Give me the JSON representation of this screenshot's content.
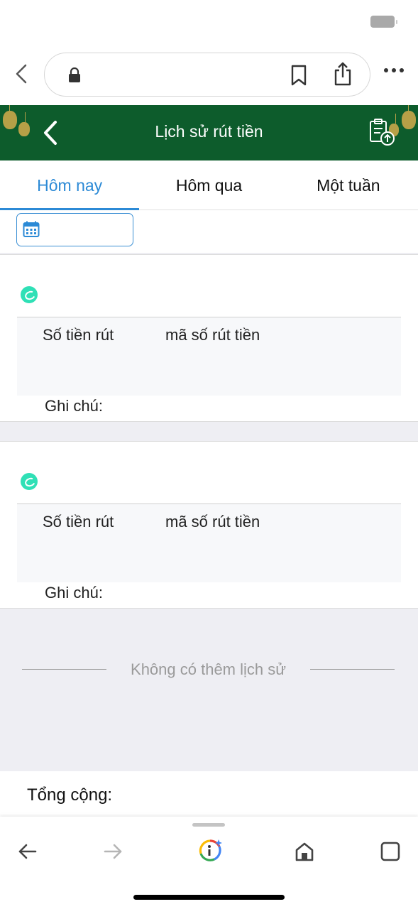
{
  "browser": {
    "icons": {
      "back": "chevron-left-icon",
      "lock": "lock-icon",
      "bookmark": "bookmark-icon",
      "share": "share-icon",
      "more": "more-horizontal-icon"
    }
  },
  "header": {
    "title": "Lịch sử rút tiền",
    "background_color": "#0d5c2c",
    "back_icon": "chevron-left-icon",
    "action_icon": "clipboard-upload-icon"
  },
  "tabs": [
    {
      "label": "Hôm nay",
      "active": true
    },
    {
      "label": "Hôm qua",
      "active": false
    },
    {
      "label": "Một tuần",
      "active": false
    }
  ],
  "accent_color": "#2c8ad6",
  "filter": {
    "calendar_icon": "calendar-icon"
  },
  "records": [
    {
      "status_icon": "status-check-icon",
      "amount_label": "Số tiền rút",
      "code_label": "mã số rút tiền",
      "note_label": "Ghi chú:"
    },
    {
      "status_icon": "status-check-icon",
      "amount_label": "Số tiền rút",
      "code_label": "mã số rút tiền",
      "note_label": "Ghi chú:"
    }
  ],
  "status_color": "#2fe0b6",
  "no_more_text": "Không có thêm lịch sử",
  "total": {
    "label": "Tổng cộng:"
  },
  "toolbar": {
    "icons": [
      "arrow-left-icon",
      "arrow-right-icon",
      "google-lens-icon",
      "home-icon",
      "tabs-icon"
    ]
  }
}
